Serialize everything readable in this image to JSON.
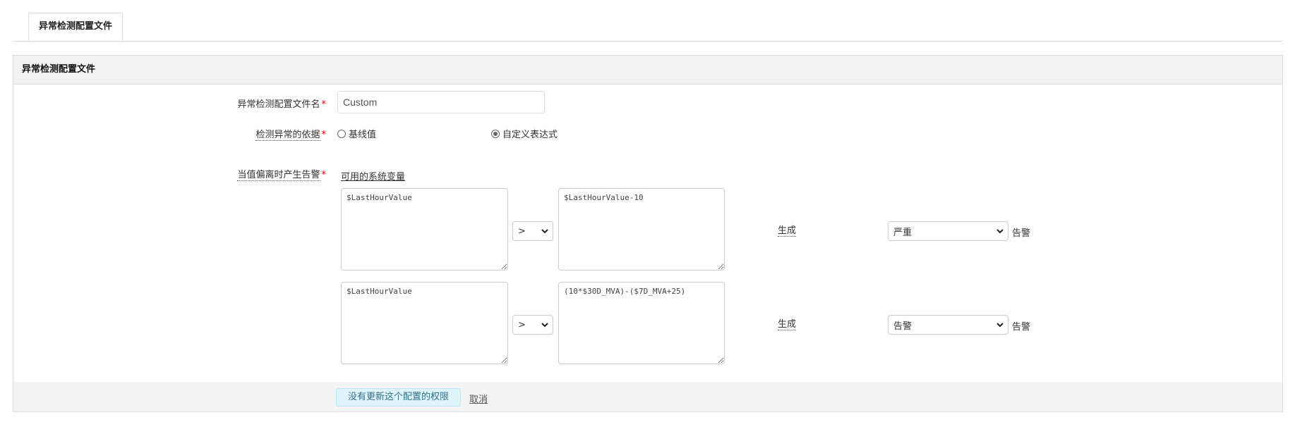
{
  "tabs": [
    {
      "label": "异常检测配置文件",
      "active": true
    }
  ],
  "panel": {
    "title": "异常检测配置文件"
  },
  "form": {
    "profile_name": {
      "label": "异常检测配置文件名",
      "required_mark": "*",
      "value": "Custom"
    },
    "basis": {
      "label": "检测异常的依据",
      "required_mark": "*",
      "options": [
        {
          "label": "基线值",
          "selected": false
        },
        {
          "label": "自定义表达式",
          "selected": true
        }
      ]
    },
    "alert_rule": {
      "label": "当值偏离时产生告警",
      "required_mark": "*",
      "variables_link": "可用的系统变量",
      "rows": [
        {
          "left_expr": "$LastHourValue",
          "operator": ">",
          "right_expr": "$LastHourValue-10",
          "generate_label": "生成",
          "severity": "严重",
          "suffix": "告警"
        },
        {
          "left_expr": "$LastHourValue",
          "operator": ">",
          "right_expr": "(10*$30D_MVA)-($7D_MVA+25)",
          "generate_label": "生成",
          "severity": "告警",
          "suffix": "告警"
        }
      ]
    }
  },
  "footer": {
    "no_permission_button": "没有更新这个配置的权限",
    "cancel_link": "取消"
  },
  "icons": {
    "chevron": "chevron-down-icon",
    "resize": "resize-handle-icon"
  }
}
